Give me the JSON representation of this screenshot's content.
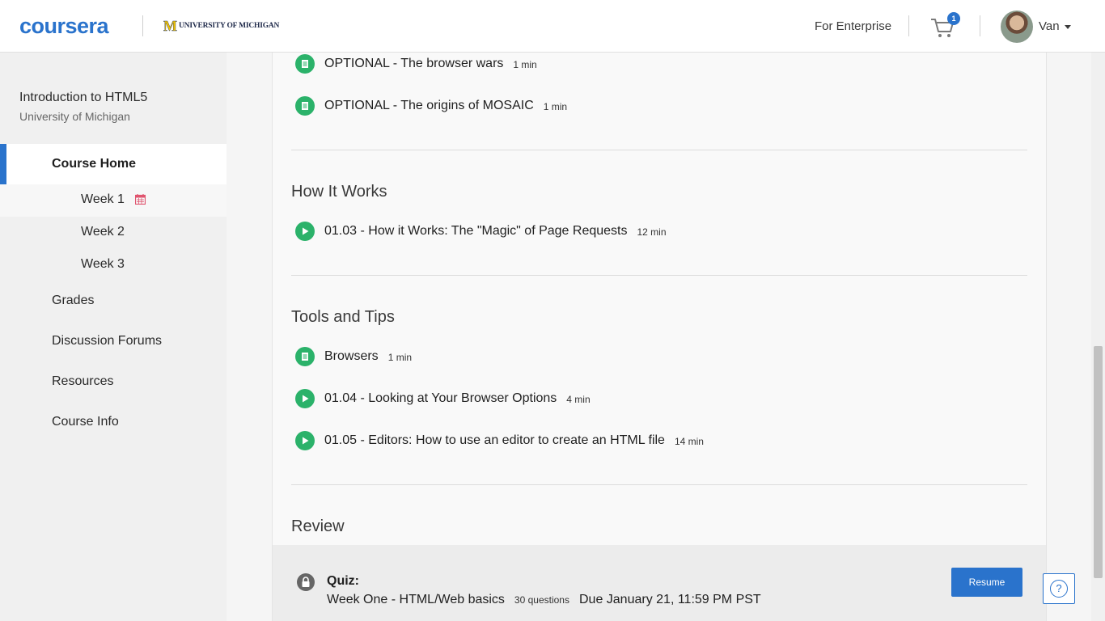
{
  "header": {
    "brand": "coursera",
    "partner": "UNIVERSITY OF MICHIGAN",
    "partner_mark": "M",
    "enterprise_link": "For Enterprise",
    "cart_count": "1",
    "user_name": "Van"
  },
  "sidebar": {
    "course_title": "Introduction to HTML5",
    "course_provider": "University of Michigan",
    "home_label": "Course Home",
    "weeks": [
      "Week 1",
      "Week 2",
      "Week 3"
    ],
    "items": [
      "Grades",
      "Discussion Forums",
      "Resources",
      "Course Info"
    ]
  },
  "sections": [
    {
      "items": [
        {
          "type": "reading",
          "title": "OPTIONAL - The browser wars",
          "duration": "1 min"
        },
        {
          "type": "reading",
          "title": "OPTIONAL - The origins of MOSAIC",
          "duration": "1 min"
        }
      ]
    },
    {
      "title": "How It Works",
      "items": [
        {
          "type": "video",
          "title": "01.03 - How it Works: The \"Magic\" of Page Requests",
          "duration": "12 min"
        }
      ]
    },
    {
      "title": "Tools and Tips",
      "items": [
        {
          "type": "reading",
          "title": "Browsers",
          "duration": "1 min"
        },
        {
          "type": "video",
          "title": "01.04 - Looking at Your Browser Options",
          "duration": "4 min"
        },
        {
          "type": "video",
          "title": "01.05 - Editors: How to use an editor to create an HTML file",
          "duration": "14 min"
        }
      ]
    },
    {
      "title": "Review"
    }
  ],
  "quiz": {
    "label": "Quiz:",
    "name": "Week One - HTML/Web basics",
    "questions": "30 questions",
    "due": "Due January 21, 11:59 PM PST",
    "button": "Resume"
  },
  "help": "?",
  "colors": {
    "brand_blue": "#2a73cc",
    "item_green": "#2bb26a",
    "calendar_pink": "#e0556f"
  }
}
